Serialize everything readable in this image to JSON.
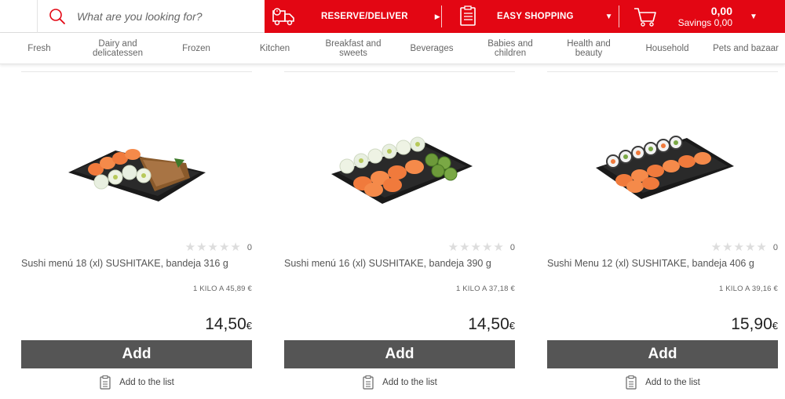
{
  "search": {
    "placeholder": "What are you looking for?"
  },
  "header": {
    "reserve_label": "RESERVE/DELIVER",
    "easy_label": "EASY SHOPPING",
    "cart_total": "0,00",
    "savings": "Savings 0,00"
  },
  "colors": {
    "brand_red": "#e30613",
    "add_button": "#555555"
  },
  "nav": {
    "items": [
      {
        "label": "Fresh"
      },
      {
        "label": "Dairy and delicatessen"
      },
      {
        "label": "Frozen"
      },
      {
        "label": "Kitchen"
      },
      {
        "label": "Breakfast and sweets"
      },
      {
        "label": "Beverages"
      },
      {
        "label": "Babies and children"
      },
      {
        "label": "Health and beauty"
      },
      {
        "label": "Household"
      },
      {
        "label": "Pets and bazaar"
      }
    ]
  },
  "products": [
    {
      "name": "Sushi menú 18 (xl) SUSHITAKE, bandeja 316 g",
      "price_per_kilo": "1 KILO A 45,89 €",
      "price": "14,50",
      "currency": "€",
      "rating_count": "0",
      "rating_stars": 0,
      "add_label": "Add",
      "list_label": "Add to the list"
    },
    {
      "name": "Sushi menú 16 (xl) SUSHITAKE, bandeja 390 g",
      "price_per_kilo": "1 KILO A 37,18 €",
      "price": "14,50",
      "currency": "€",
      "rating_count": "0",
      "rating_stars": 0,
      "add_label": "Add",
      "list_label": "Add to the list"
    },
    {
      "name": "Sushi Menu 12 (xl) SUSHITAKE, bandeja 406 g",
      "price_per_kilo": "1 KILO A 39,16 €",
      "price": "15,90",
      "currency": "€",
      "rating_count": "0",
      "rating_stars": 0,
      "add_label": "Add",
      "list_label": "Add to the list"
    }
  ]
}
